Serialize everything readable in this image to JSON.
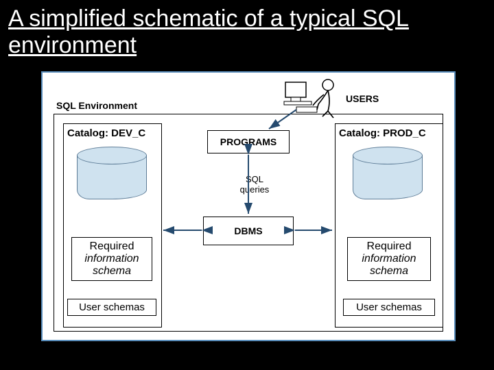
{
  "title": "A simplified schematic of a typical SQL environment",
  "env_label": "SQL Environment",
  "catalog_left": "Catalog: DEV_C",
  "catalog_right": "Catalog: PROD_C",
  "info_line1": "Required",
  "info_line2": "information",
  "info_line3": "schema",
  "user_schemas": "User schemas",
  "programs": "PROGRAMS",
  "dbms": "DBMS",
  "sql_queries": "SQL\nqueries",
  "users": "USERS"
}
